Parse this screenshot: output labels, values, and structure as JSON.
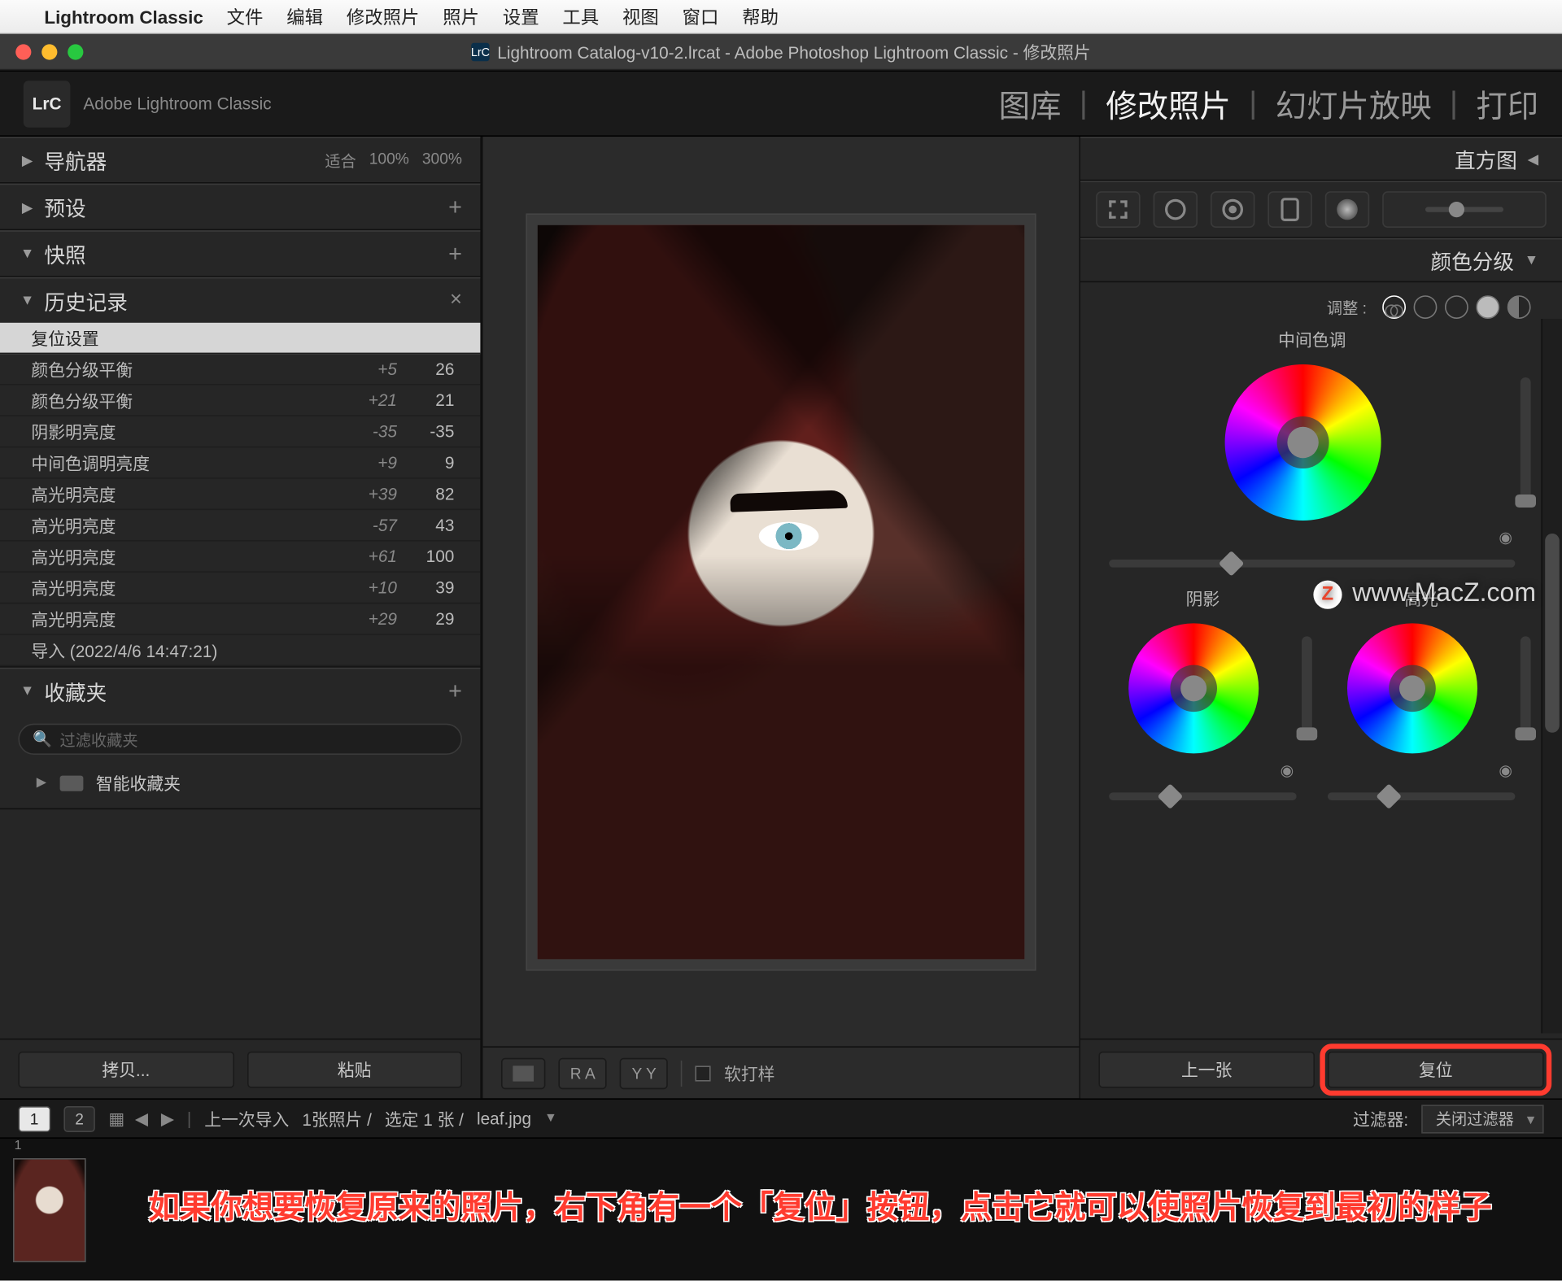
{
  "menubar": {
    "app": "Lightroom Classic",
    "items": [
      "文件",
      "编辑",
      "修改照片",
      "照片",
      "设置",
      "工具",
      "视图",
      "窗口",
      "帮助"
    ]
  },
  "window": {
    "icon": "LrC",
    "title": "Lightroom Catalog-v10-2.lrcat - Adobe Photoshop Lightroom Classic - 修改照片"
  },
  "topbar": {
    "logo": "LrC",
    "brand": "Adobe Lightroom Classic",
    "tabs": [
      "图库",
      "修改照片",
      "幻灯片放映",
      "打印"
    ],
    "active": "修改照片"
  },
  "left": {
    "navigator": {
      "label": "导航器",
      "levels": [
        "适合",
        "100%",
        "300%"
      ]
    },
    "presets": {
      "label": "预设"
    },
    "snapshots": {
      "label": "快照"
    },
    "history": {
      "label": "历史记录",
      "rows": [
        {
          "name": "复位设置",
          "d1": "",
          "d2": ""
        },
        {
          "name": "颜色分级平衡",
          "d1": "+5",
          "d2": "26"
        },
        {
          "name": "颜色分级平衡",
          "d1": "+21",
          "d2": "21"
        },
        {
          "name": "阴影明亮度",
          "d1": "-35",
          "d2": "-35"
        },
        {
          "name": "中间色调明亮度",
          "d1": "+9",
          "d2": "9"
        },
        {
          "name": "高光明亮度",
          "d1": "+39",
          "d2": "82"
        },
        {
          "name": "高光明亮度",
          "d1": "-57",
          "d2": "43"
        },
        {
          "name": "高光明亮度",
          "d1": "+61",
          "d2": "100"
        },
        {
          "name": "高光明亮度",
          "d1": "+10",
          "d2": "39"
        },
        {
          "name": "高光明亮度",
          "d1": "+29",
          "d2": "29"
        },
        {
          "name": "导入 (2022/4/6 14:47:21)",
          "d1": "",
          "d2": ""
        }
      ]
    },
    "collections": {
      "label": "收藏夹",
      "search_placeholder": "过滤收藏夹",
      "smart": "智能收藏夹"
    },
    "buttons": {
      "copy": "拷贝...",
      "paste": "粘贴"
    }
  },
  "center": {
    "toolbar": {
      "ra": "R A",
      "yy": "Y Y",
      "softproof": "软打样"
    }
  },
  "right": {
    "histogram": "直方图",
    "panel_title": "颜色分级",
    "adjust_label": "调整 :",
    "midtones": "中间色调",
    "shadows": "阴影",
    "highlights": "高光",
    "buttons": {
      "prev": "上一张",
      "reset": "复位"
    }
  },
  "statusbar": {
    "pages": [
      "1",
      "2"
    ],
    "grid_icons": true,
    "breadcrumb": "上一次导入",
    "count": "1张照片 /",
    "selected": "选定 1 张 /",
    "filename": "leaf.jpg",
    "filter_label": "过滤器:",
    "filter_value": "关闭过滤器"
  },
  "filmstrip": {
    "thumb_index": "1"
  },
  "caption": "如果你想要恢复原来的照片，右下角有一个「复位」按钮，点击它就可以使照片恢复到最初的样子",
  "watermark": "www.MacZ.com"
}
